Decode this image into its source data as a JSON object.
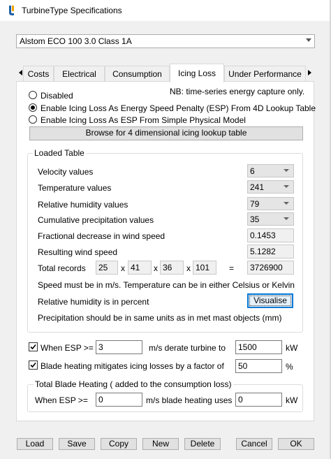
{
  "window": {
    "title": "TurbineType Specifications",
    "icon": "app-logo-icon"
  },
  "turbine_select": {
    "value": "Alstom ECO 100 3.0 Class 1A"
  },
  "tabs": [
    {
      "label": "Costs"
    },
    {
      "label": "Electrical"
    },
    {
      "label": "Consumption"
    },
    {
      "label": "Icing Loss",
      "active": true
    },
    {
      "label": "Under Performance"
    }
  ],
  "note": "NB: time-series energy capture only.",
  "options": [
    {
      "label": "Disabled",
      "checked": false
    },
    {
      "label": "Enable Icing Loss As Energy Speed Penalty (ESP) From 4D Lookup Table",
      "checked": true
    },
    {
      "label": "Enable Icing Loss As ESP From Simple Physical Model",
      "checked": false
    }
  ],
  "browse_button": "Browse for 4 dimensional icing lookup table",
  "loaded_table": {
    "title": "Loaded Table",
    "velocity": {
      "label": "Velocity values",
      "value": "6"
    },
    "temperature": {
      "label": "Temperature values",
      "value": "241"
    },
    "humidity": {
      "label": "Relative humidity values",
      "value": "79"
    },
    "precipitation": {
      "label": "Cumulative precipitation values",
      "value": "35"
    },
    "fractional_decrease": {
      "label": "Fractional decrease in wind speed",
      "value": "0.1453"
    },
    "resulting_speed": {
      "label": "Resulting wind speed",
      "value": "5.1282"
    },
    "total_records": {
      "label": "Total records",
      "dims": [
        "25",
        "41",
        "36",
        "101"
      ],
      "times": "x",
      "equals": "=",
      "result": "3726900"
    },
    "note_units": "Speed must be in m/s. Temperature can be in either Celsius or Kelvin",
    "note_humidity": "Relative humidity is in percent",
    "visualise_button": "Visualise",
    "note_precip": "Precipitation should be in same units as in met mast objects (mm)"
  },
  "derate": {
    "checked": true,
    "label": "When ESP >=",
    "esp_value": "3",
    "mid_label": "m/s derate turbine to",
    "power_value": "1500",
    "unit": "kW"
  },
  "blade_heating_mitigation": {
    "checked": true,
    "label": "Blade heating mitigates icing losses by a factor of",
    "value": "50",
    "unit": "%"
  },
  "total_blade_heating": {
    "title": "Total Blade Heating ( added to the consumption loss)",
    "label": "When ESP >=",
    "esp_value": "0",
    "mid_label": "m/s blade heating uses",
    "power_value": "0",
    "unit": "kW"
  },
  "footer_buttons": {
    "load": "Load",
    "save": "Save",
    "copy": "Copy",
    "new": "New",
    "delete": "Delete",
    "cancel": "Cancel",
    "ok": "OK"
  }
}
